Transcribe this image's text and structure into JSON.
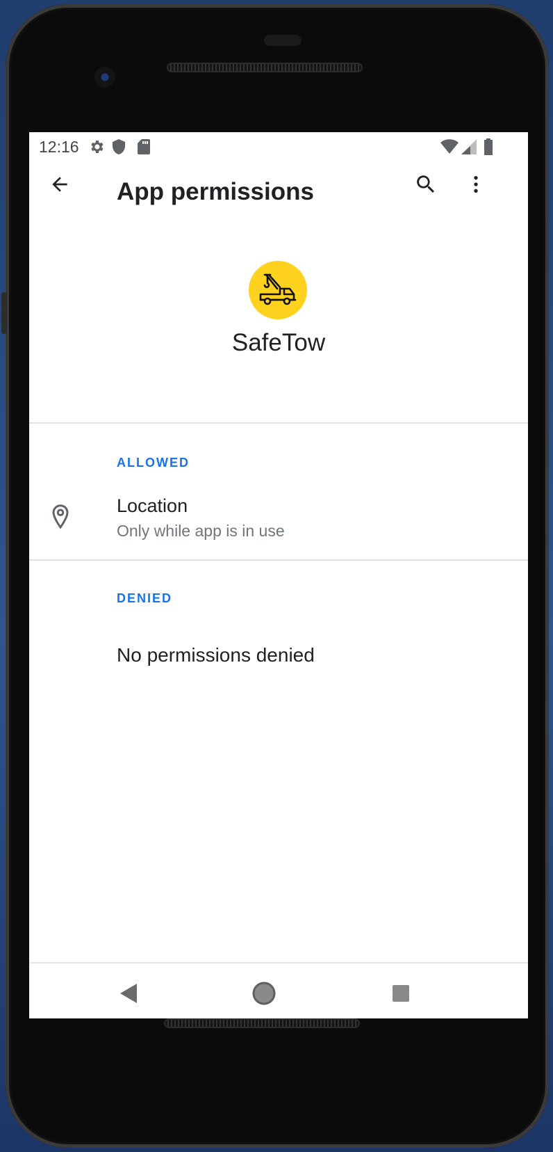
{
  "status_bar": {
    "time": "12:16",
    "left_icons": [
      "settings-icon",
      "shield-icon",
      "sd-card-icon"
    ],
    "right_icons": [
      "wifi-icon",
      "cellular-signal-icon",
      "battery-icon"
    ]
  },
  "app_bar": {
    "title": "App permissions",
    "actions": [
      "back-arrow-icon",
      "search-icon",
      "more-vert-icon"
    ]
  },
  "app": {
    "name": "SafeTow",
    "icon": "tow-truck-icon",
    "icon_bg_color": "#FFD21F"
  },
  "sections": {
    "allowed": {
      "label": "ALLOWED",
      "items": [
        {
          "title": "Location",
          "subtitle": "Only while app is in use",
          "icon": "location-pin-icon"
        }
      ]
    },
    "denied": {
      "label": "DENIED",
      "empty_text": "No permissions denied"
    }
  },
  "nav_bar": {
    "buttons": [
      "back-triangle-icon",
      "home-circle-icon",
      "recents-square-icon"
    ]
  },
  "colors": {
    "accent": "#1A73E8",
    "text_primary": "#202124",
    "text_secondary": "#70757A"
  }
}
